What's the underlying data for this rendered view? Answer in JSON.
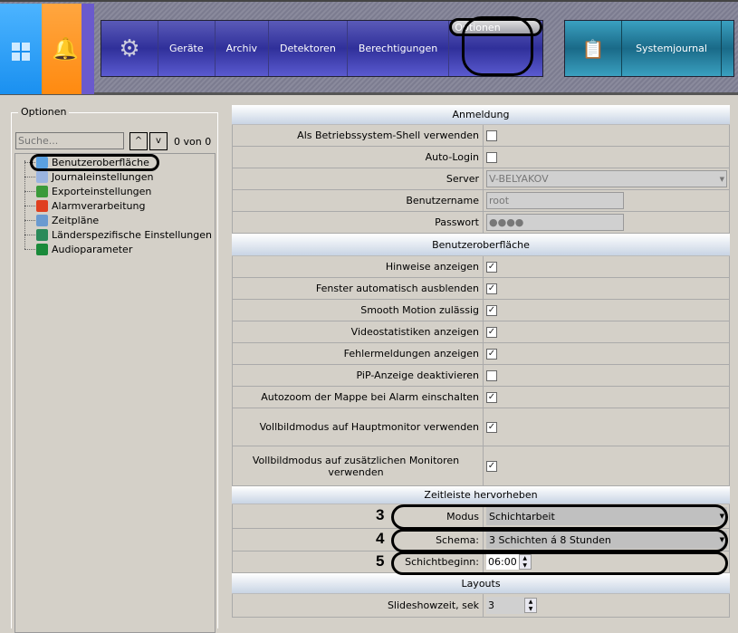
{
  "nav": {
    "items": [
      "Geräte",
      "Archiv",
      "Detektoren",
      "Berechtigungen",
      "Optionen"
    ],
    "systemjournal": "Systemjournal"
  },
  "left": {
    "title": "Optionen",
    "search_placeholder": "Suche...",
    "up": "^",
    "down": "v",
    "count": "0 von 0",
    "tree": [
      {
        "label": "Benutzeroberfläche",
        "color": "#5aa0e0"
      },
      {
        "label": "Journaleinstellungen",
        "color": "#9ab4e0"
      },
      {
        "label": "Exporteinstellungen",
        "color": "#3a9a3a"
      },
      {
        "label": "Alarmverarbeitung",
        "color": "#e04020"
      },
      {
        "label": "Zeitpläne",
        "color": "#6a9ad0"
      },
      {
        "label": "Länderspezifische Einstellungen",
        "color": "#2a8a5a"
      },
      {
        "label": "Audioparameter",
        "color": "#1a8a3a"
      }
    ]
  },
  "sections": {
    "anmeldung": "Anmeldung",
    "shell": "Als Betriebssystem-Shell verwenden",
    "autologin": "Auto-Login",
    "server": "Server",
    "server_val": "V-BELYAKOV",
    "user": "Benutzername",
    "user_val": "root",
    "pass": "Passwort",
    "pass_val": "●●●●",
    "ui": "Benutzeroberfläche",
    "ui_rows": [
      {
        "label": "Hinweise anzeigen",
        "checked": true
      },
      {
        "label": "Fenster automatisch ausblenden",
        "checked": true
      },
      {
        "label": "Smooth Motion zulässig",
        "checked": true
      },
      {
        "label": "Videostatistiken anzeigen",
        "checked": true
      },
      {
        "label": "Fehlermeldungen anzeigen",
        "checked": true
      },
      {
        "label": "PiP-Anzeige deaktivieren",
        "checked": false
      },
      {
        "label": "Autozoom der Mappe bei Alarm einschalten",
        "checked": true
      },
      {
        "label": "Vollbildmodus auf Hauptmonitor verwenden",
        "checked": true
      },
      {
        "label": "Vollbildmodus auf zusätzlichen Monitoren verwenden",
        "checked": true
      }
    ],
    "zeit": "Zeitleiste hervorheben",
    "modus": "Modus",
    "modus_val": "Schichtarbeit",
    "schema": "Schema:",
    "schema_val": "3 Schichten á 8 Stunden",
    "beginn": "Schichtbeginn:",
    "beginn_val": "06:00",
    "layouts": "Layouts",
    "slide": "Slideshowzeit, sek",
    "slide_val": "3"
  },
  "annotations": [
    "3",
    "4",
    "5"
  ]
}
